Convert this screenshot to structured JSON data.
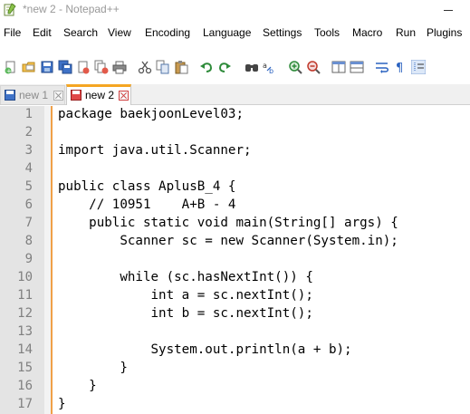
{
  "window": {
    "title": "*new 2 - Notepad++"
  },
  "menu": [
    "File",
    "Edit",
    "Search",
    "View",
    "Encoding",
    "Language",
    "Settings",
    "Tools",
    "Macro",
    "Run",
    "Plugins"
  ],
  "toolbar": {
    "icons": [
      "new-file-icon",
      "open-file-icon",
      "save-icon",
      "save-all-icon",
      "close-icon",
      "close-all-icon",
      "print-icon",
      "cut-icon",
      "copy-icon",
      "paste-icon",
      "undo-icon",
      "redo-icon",
      "find-icon",
      "replace-icon",
      "zoom-in-icon",
      "zoom-out-icon",
      "sync-vertical-icon",
      "sync-horizontal-icon",
      "word-wrap-icon",
      "show-all-chars-icon",
      "indent-guide-icon"
    ]
  },
  "tabs": [
    {
      "label": "new 1",
      "active": false
    },
    {
      "label": "new 2",
      "active": true
    }
  ],
  "editor": {
    "lines": [
      {
        "num": "1",
        "text": "package baekjoonLevel03;"
      },
      {
        "num": "2",
        "text": ""
      },
      {
        "num": "3",
        "text": "import java.util.Scanner;"
      },
      {
        "num": "4",
        "text": ""
      },
      {
        "num": "5",
        "text": "public class AplusB_4 {"
      },
      {
        "num": "6",
        "text": "    // 10951    A+B - 4"
      },
      {
        "num": "7",
        "text": "    public static void main(String[] args) {"
      },
      {
        "num": "8",
        "text": "        Scanner sc = new Scanner(System.in);"
      },
      {
        "num": "9",
        "text": ""
      },
      {
        "num": "10",
        "text": "        while (sc.hasNextInt()) {"
      },
      {
        "num": "11",
        "text": "            int a = sc.nextInt();"
      },
      {
        "num": "12",
        "text": "            int b = sc.nextInt();"
      },
      {
        "num": "13",
        "text": ""
      },
      {
        "num": "14",
        "text": "            System.out.println(a + b);"
      },
      {
        "num": "15",
        "text": "        }"
      },
      {
        "num": "16",
        "text": "    }"
      },
      {
        "num": "17",
        "text": "}"
      }
    ]
  },
  "colors": {
    "fold_margin_accent": "#f0a048",
    "active_tab_accent": "#f5a623",
    "gutter": "#e4e4e4"
  }
}
